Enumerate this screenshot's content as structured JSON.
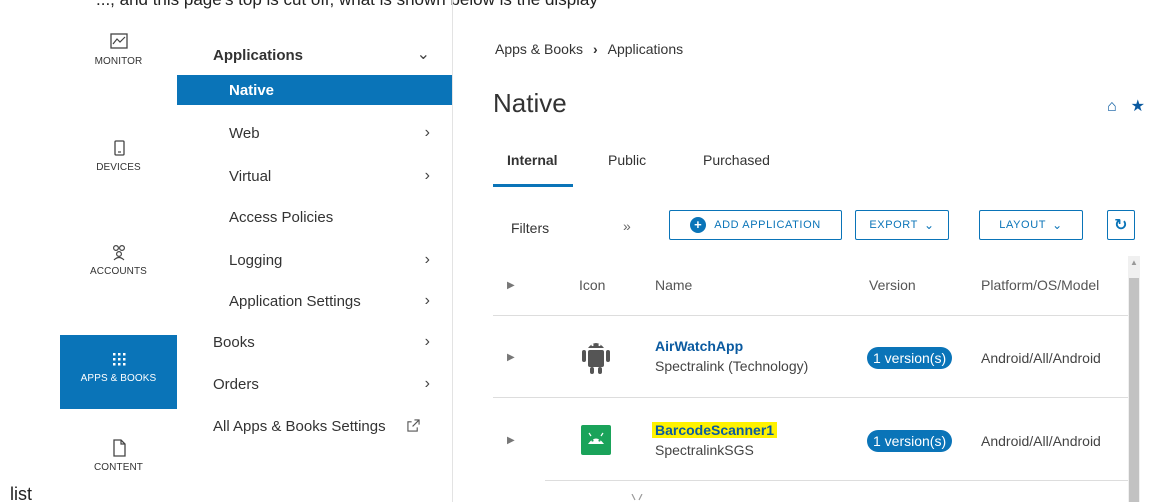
{
  "top_caption": "..., and this page's top is cut off; what is shown below is the display",
  "rail": {
    "items": [
      {
        "label": "MONITOR",
        "icon": "monitor-icon"
      },
      {
        "label": "DEVICES",
        "icon": "device-icon"
      },
      {
        "label": "ACCOUNTS",
        "icon": "accounts-icon"
      },
      {
        "label": "APPS & BOOKS",
        "icon": "apps-grid-icon"
      },
      {
        "label": "CONTENT",
        "icon": "document-icon"
      }
    ],
    "active": "APPS & BOOKS"
  },
  "menu": {
    "items": [
      {
        "label": "Applications",
        "chevron": "⌄"
      },
      {
        "label": "Native"
      },
      {
        "label": "Web",
        "chevron": "›"
      },
      {
        "label": "Virtual",
        "chevron": "›"
      },
      {
        "label": "Access Policies"
      },
      {
        "label": "Logging",
        "chevron": "›"
      },
      {
        "label": "Application Settings",
        "chevron": "›"
      },
      {
        "label": "Books",
        "chevron": "›"
      },
      {
        "label": "Orders",
        "chevron": "›"
      },
      {
        "label": "All Apps & Books Settings",
        "external_icon": "external-link-icon"
      }
    ]
  },
  "breadcrumb": {
    "root": "Apps & Books",
    "separator": "›",
    "current": "Applications"
  },
  "page_title": "Native",
  "title_icons": {
    "home": "⌂",
    "star": "★"
  },
  "tabs": [
    "Internal",
    "Public",
    "Purchased"
  ],
  "toolbar": {
    "filters": "Filters",
    "expand": "»",
    "add_application": "ADD APPLICATION",
    "export": "EXPORT",
    "layout": "LAYOUT",
    "refresh": "↻",
    "dropdown_caret": "⌄"
  },
  "grid": {
    "columns": [
      "Icon",
      "Name",
      "Version",
      "Platform/OS/Model"
    ],
    "rows": [
      {
        "name": "AirWatchApp",
        "org": "Spectralink (Technology)",
        "version": "1 version(s)",
        "platform": "Android/All/Android"
      },
      {
        "name": "BarcodeScanner1",
        "org": "SpectralinkSGS",
        "version": "1 version(s)",
        "platform": "Android/All/Android"
      }
    ]
  },
  "colors": {
    "accent": "#0a74b8",
    "link": "#0a5aa0",
    "highlight": "#fff200"
  },
  "bottom_caption": "list"
}
